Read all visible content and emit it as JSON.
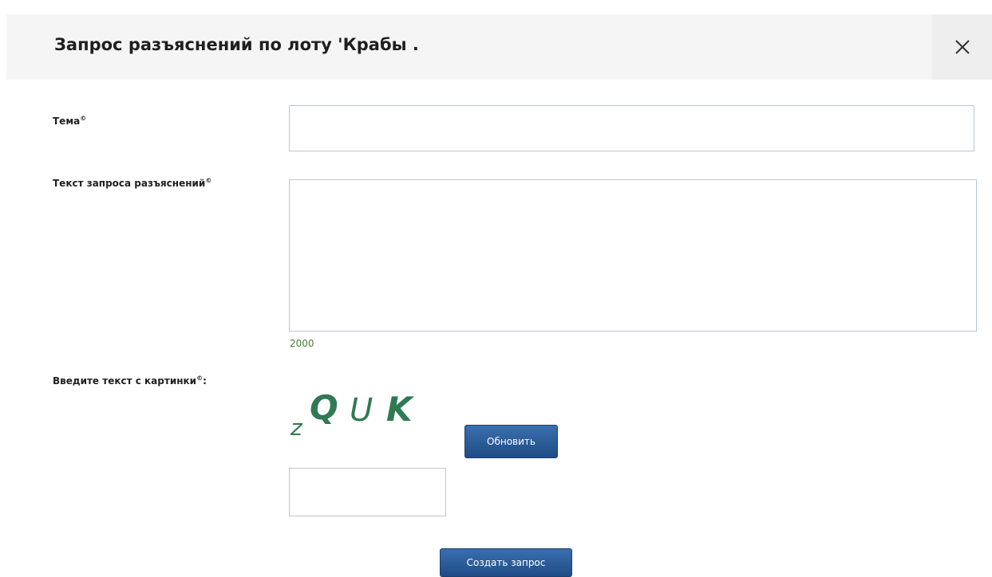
{
  "dialog": {
    "title": "Запрос разъяснений по лоту 'Крабы .",
    "close_icon": "close-icon"
  },
  "form": {
    "subject": {
      "label": "Тема",
      "required_mark": "©",
      "value": ""
    },
    "request_text": {
      "label": "Текст запроса разъяснений",
      "required_mark": "©",
      "value": "",
      "char_counter": "2000"
    },
    "captcha": {
      "label": "Введите текст с картинки",
      "required_mark": "©",
      "label_suffix": ":",
      "image_text": "zQUK",
      "image_color": "#2f7a52",
      "refresh_label": "Обновить",
      "value": ""
    },
    "submit_label": "Создать запрос"
  },
  "colors": {
    "button": "#2a5a97",
    "field_border": "#b9c6da",
    "header_bg": "#f5f5f5",
    "counter_text": "#4a7a36"
  }
}
